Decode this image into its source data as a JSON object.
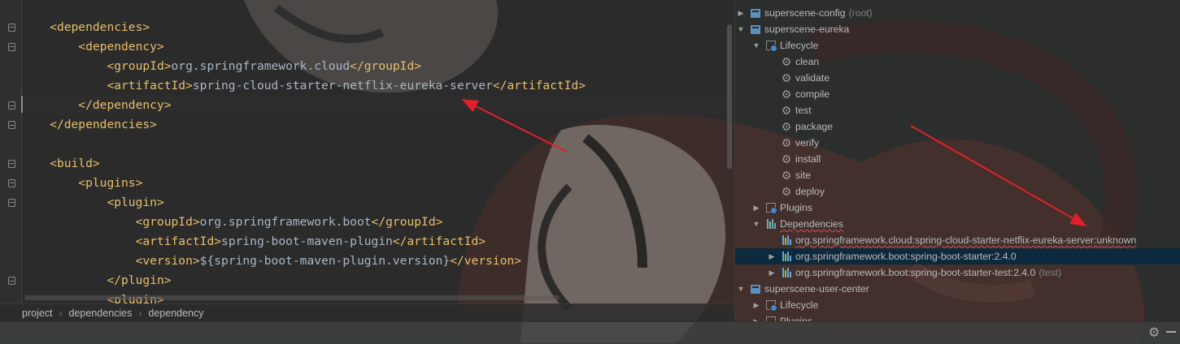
{
  "editor": {
    "lines": [
      {
        "indent": "    ",
        "parts": [
          [
            "tag",
            "<dependencies>"
          ]
        ]
      },
      {
        "indent": "        ",
        "parts": [
          [
            "tag",
            "<dependency>"
          ]
        ]
      },
      {
        "indent": "            ",
        "parts": [
          [
            "tag",
            "<groupId>"
          ],
          [
            "txt",
            "org.springframework.cloud"
          ],
          [
            "tag",
            "</groupId>"
          ]
        ]
      },
      {
        "indent": "            ",
        "parts": [
          [
            "tag",
            "<artifactId>"
          ],
          [
            "txt",
            "spring-cloud-starter-netflix-eureka-server"
          ],
          [
            "tag",
            "</artifactId>"
          ]
        ]
      },
      {
        "indent": "        ",
        "parts": [
          [
            "tag",
            "</dependency>"
          ]
        ]
      },
      {
        "indent": "    ",
        "parts": [
          [
            "tag",
            "</dependencies>"
          ]
        ]
      },
      {
        "indent": "",
        "parts": []
      },
      {
        "indent": "    ",
        "parts": [
          [
            "tag",
            "<build>"
          ]
        ]
      },
      {
        "indent": "        ",
        "parts": [
          [
            "tag",
            "<plugins>"
          ]
        ]
      },
      {
        "indent": "            ",
        "parts": [
          [
            "tag",
            "<plugin>"
          ]
        ]
      },
      {
        "indent": "                ",
        "parts": [
          [
            "tag",
            "<groupId>"
          ],
          [
            "txt",
            "org.springframework.boot"
          ],
          [
            "tag",
            "</groupId>"
          ]
        ]
      },
      {
        "indent": "                ",
        "parts": [
          [
            "tag",
            "<artifactId>"
          ],
          [
            "txt",
            "spring-boot-maven-plugin"
          ],
          [
            "tag",
            "</artifactId>"
          ]
        ]
      },
      {
        "indent": "                ",
        "parts": [
          [
            "tag",
            "<version>"
          ],
          [
            "txt",
            "${spring-boot-maven-plugin.version}"
          ],
          [
            "tag",
            "</version>"
          ]
        ]
      },
      {
        "indent": "            ",
        "parts": [
          [
            "tag",
            "</plugin>"
          ]
        ]
      },
      {
        "indent": "            ",
        "parts": [
          [
            "tag",
            "<plugin>"
          ]
        ]
      }
    ]
  },
  "breadcrumb": {
    "items": [
      "project",
      "dependencies",
      "dependency"
    ]
  },
  "maven_tree": {
    "rows": [
      {
        "name": "tree-row-superscene-config",
        "label": "superscene-config",
        "suffix": "(root)",
        "toggle": "collapsed",
        "icon": "project-icon"
      },
      {
        "name": "tree-row-superscene-eureka",
        "label": "superscene-eureka",
        "suffix": "",
        "toggle": "expanded",
        "icon": "project-icon"
      },
      {
        "name": "tree-row-lifecycle",
        "label": "Lifecycle",
        "suffix": "",
        "toggle": "expanded",
        "icon": "lifecycle-icon"
      },
      {
        "name": "tree-row-clean",
        "label": "clean",
        "suffix": "",
        "toggle": "none",
        "icon": "gear-icon"
      },
      {
        "name": "tree-row-validate",
        "label": "validate",
        "suffix": "",
        "toggle": "none",
        "icon": "gear-icon"
      },
      {
        "name": "tree-row-compile",
        "label": "compile",
        "suffix": "",
        "toggle": "none",
        "icon": "gear-icon"
      },
      {
        "name": "tree-row-test",
        "label": "test",
        "suffix": "",
        "toggle": "none",
        "icon": "gear-icon"
      },
      {
        "name": "tree-row-package",
        "label": "package",
        "suffix": "",
        "toggle": "none",
        "icon": "gear-icon"
      },
      {
        "name": "tree-row-verify",
        "label": "verify",
        "suffix": "",
        "toggle": "none",
        "icon": "gear-icon"
      },
      {
        "name": "tree-row-install",
        "label": "install",
        "suffix": "",
        "toggle": "none",
        "icon": "gear-icon"
      },
      {
        "name": "tree-row-site",
        "label": "site",
        "suffix": "",
        "toggle": "none",
        "icon": "gear-icon"
      },
      {
        "name": "tree-row-deploy",
        "label": "deploy",
        "suffix": "",
        "toggle": "none",
        "icon": "gear-icon"
      },
      {
        "name": "tree-row-plugins",
        "label": "Plugins",
        "suffix": "",
        "toggle": "collapsed",
        "icon": "plugins-icon"
      },
      {
        "name": "tree-row-dependencies",
        "label": "Dependencies",
        "suffix": "",
        "toggle": "expanded",
        "icon": "dependencies-icon",
        "wavy": true
      },
      {
        "name": "tree-row-eureka-server-dependency",
        "label": "org.springframework.cloud:spring-cloud-starter-netflix-eureka-server:unknown",
        "suffix": "",
        "toggle": "none",
        "icon": "library-icon",
        "wavy": true
      },
      {
        "name": "tree-row-spring-boot-starter",
        "label": "org.springframework.boot:spring-boot-starter:2.4.0",
        "suffix": "",
        "toggle": "collapsed",
        "icon": "library-icon",
        "selected": true
      },
      {
        "name": "tree-row-spring-boot-starter-test",
        "label": "org.springframework.boot:spring-boot-starter-test:2.4.0",
        "suffix": "(test)",
        "toggle": "collapsed",
        "icon": "library-icon"
      },
      {
        "name": "tree-row-superscene-user-center",
        "label": "superscene-user-center",
        "suffix": "",
        "toggle": "expanded",
        "icon": "project-icon"
      },
      {
        "name": "tree-row-user-center-lifecycle",
        "label": "Lifecycle",
        "suffix": "",
        "toggle": "collapsed",
        "icon": "lifecycle-icon"
      },
      {
        "name": "tree-row-user-center-plugins",
        "label": "Plugins",
        "suffix": "",
        "toggle": "collapsed",
        "icon": "plugins-icon"
      }
    ]
  },
  "colors": {
    "xml_tag": "#e8bf6a",
    "xml_text": "#a9b7c6",
    "selection": "#0d293e",
    "annotation_arrow": "#e0202a"
  }
}
